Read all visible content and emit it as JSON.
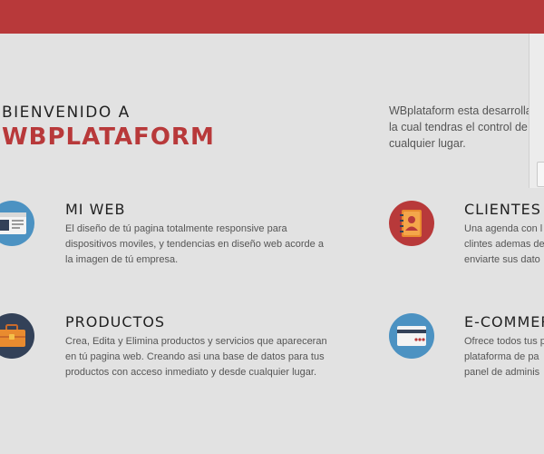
{
  "header": {
    "bar_color": "#b8393a"
  },
  "hero": {
    "welcome": "BIENVENIDO A",
    "brand": "WBPLATAFORM",
    "intro_lines": [
      "WBplataform esta desarrollad",
      "la cual tendras el control de t",
      "cualquier lugar."
    ]
  },
  "features": [
    {
      "icon": "browser-window-icon",
      "title": "MI WEB",
      "desc_lines": [
        "El diseño de tú pagina totalmente responsive para",
        "dispositivos moviles, y tendencias en diseño web acorde a",
        "la imagen de tú empresa."
      ]
    },
    {
      "icon": "address-book-icon",
      "title": "CLIENTES",
      "desc_lines": [
        "Una agenda con l",
        "clintes ademas de",
        "enviarte sus dato"
      ]
    },
    {
      "icon": "briefcase-icon",
      "title": "PRODUCTOS",
      "desc_lines": [
        "Crea, Edita y Elimina productos y servicios que apareceran",
        "en tú pagina web. Creando asi una base de datos para tus",
        "productos con acceso inmediato y desde cualquier lugar."
      ]
    },
    {
      "icon": "credit-card-icon",
      "title": "E-COMMER",
      "desc_lines": [
        "Ofrece todos tus p",
        "plataforma de pa",
        "panel de adminis"
      ]
    }
  ],
  "colors": {
    "accent": "#b8393a",
    "background": "#e2e2e2",
    "icon_blue": "#4c92c2",
    "icon_red": "#b8393a",
    "icon_navy": "#334158"
  }
}
